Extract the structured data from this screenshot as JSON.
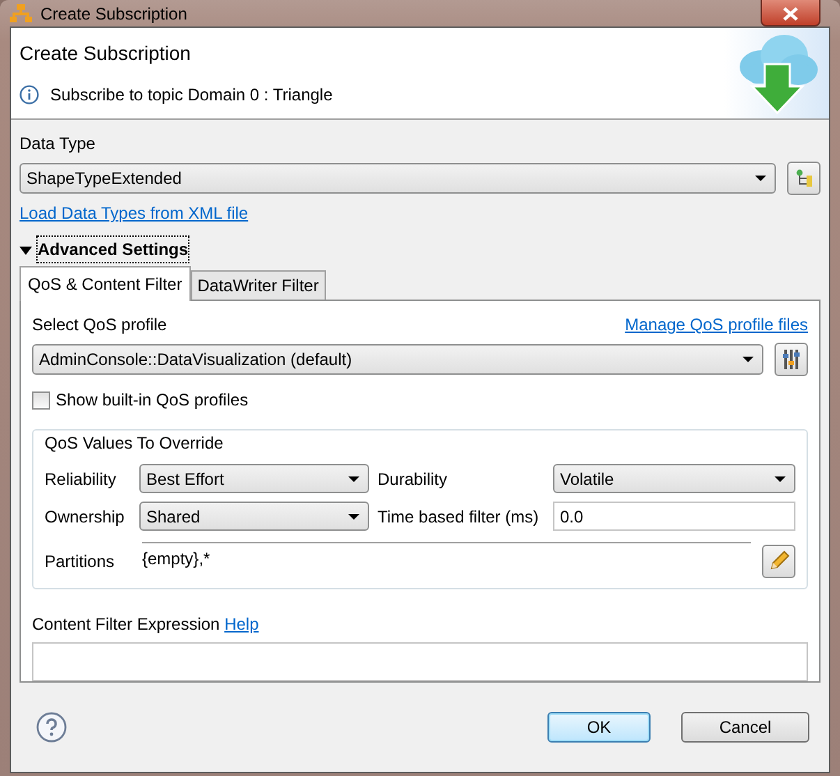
{
  "window": {
    "title": "Create Subscription"
  },
  "header": {
    "title": "Create Subscription",
    "message": "Subscribe to topic Domain 0 : Triangle"
  },
  "data_type": {
    "label": "Data Type",
    "value": "ShapeTypeExtended"
  },
  "load_link": "Load Data Types from XML file",
  "advanced": {
    "label": "Advanced Settings",
    "expanded": true
  },
  "tabs": [
    {
      "label": "QoS & Content Filter",
      "selected": true
    },
    {
      "label": "DataWriter Filter",
      "selected": false
    }
  ],
  "qos_profile": {
    "label": "Select QoS profile",
    "link": "Manage QoS profile files",
    "value": "AdminConsole::DataVisualization (default)"
  },
  "show_builtin": {
    "label": "Show built-in QoS profiles",
    "checked": false
  },
  "override": {
    "title": "QoS Values To Override",
    "fields": [
      {
        "label": "Reliability",
        "kind": "select",
        "value": "Best Effort"
      },
      {
        "label": "Durability",
        "kind": "select",
        "value": "Volatile"
      },
      {
        "label": "Ownership",
        "kind": "select",
        "value": "Shared"
      },
      {
        "label": "Time based filter (ms)",
        "kind": "text",
        "value": "0.0"
      }
    ],
    "partitions": {
      "label": "Partitions",
      "value": "{empty},*"
    }
  },
  "filter": {
    "label": "Content Filter Expression",
    "link": "Help"
  },
  "buttons": [
    {
      "label": "OK",
      "default": true
    },
    {
      "label": "Cancel",
      "default": false
    }
  ]
}
